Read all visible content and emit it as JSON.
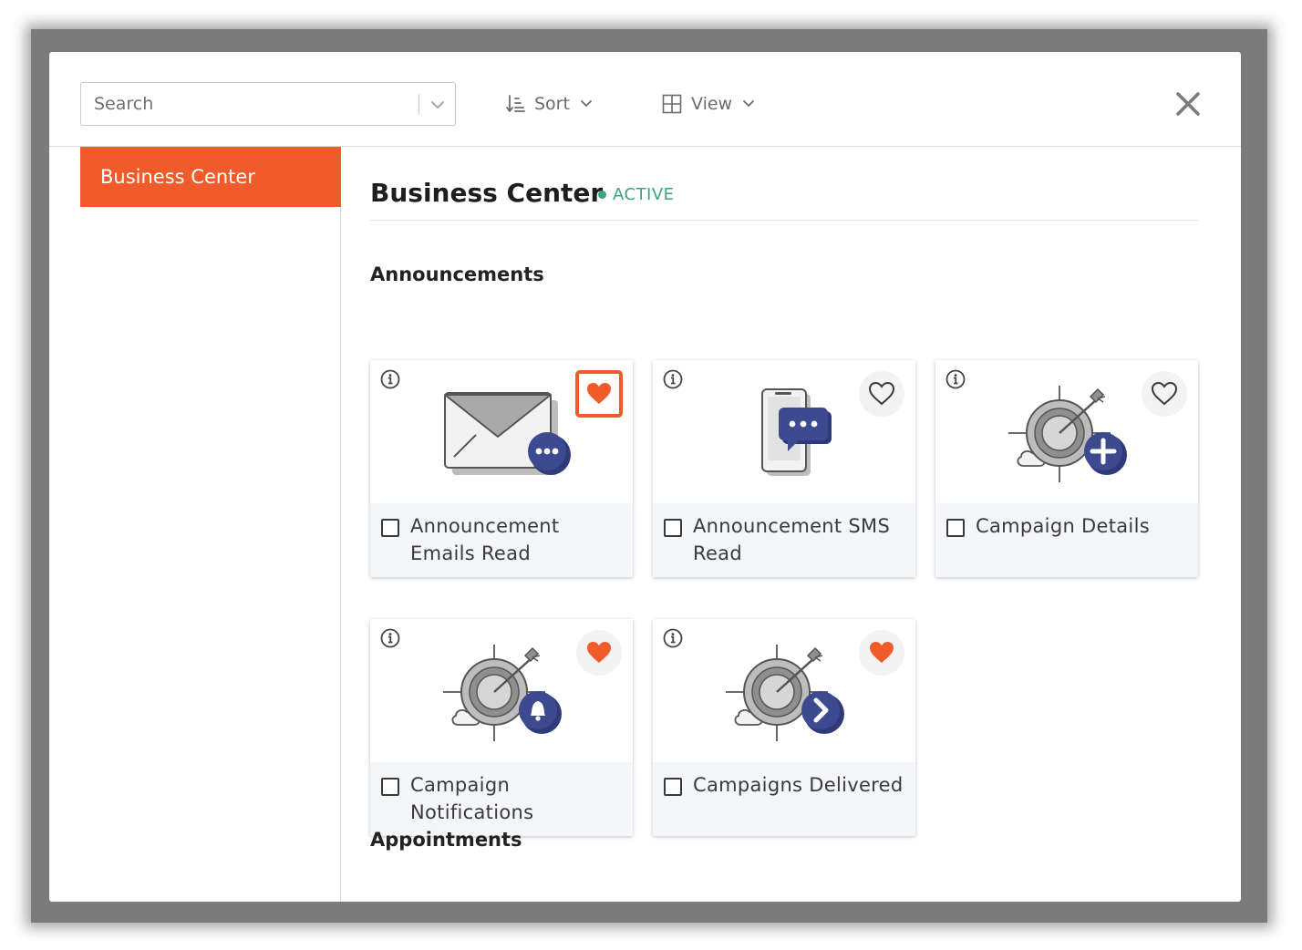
{
  "search": {
    "placeholder": "Search"
  },
  "toolbar": {
    "sort_label": "Sort",
    "view_label": "View"
  },
  "sidebar": {
    "items": [
      {
        "label": "Business Center",
        "active": true
      }
    ]
  },
  "header": {
    "title": "Business Center",
    "status": "ACTIVE",
    "status_color": "#3aa57a"
  },
  "accent_color": "#ef5b2a",
  "icon_color": "#3d4a8f",
  "sections": [
    {
      "title": "Announcements",
      "cards": [
        {
          "label": "Announcement Emails Read",
          "icon": "envelope-chat-icon",
          "favorited": true,
          "checked": false
        },
        {
          "label": "Announcement SMS Read",
          "icon": "phone-chat-icon",
          "favorited": false,
          "checked": false
        },
        {
          "label": "Campaign Details",
          "icon": "target-plus-icon",
          "favorited": false,
          "checked": false
        },
        {
          "label": "Campaign Notifications",
          "icon": "target-bell-icon",
          "favorited": true,
          "checked": false
        },
        {
          "label": "Campaigns Delivered",
          "icon": "target-arrow-icon",
          "favorited": true,
          "checked": false
        }
      ]
    },
    {
      "title": "Appointments",
      "cards": [
        {
          "label": "",
          "favorited": true
        },
        {
          "label": "",
          "favorited": true
        },
        {
          "label": "",
          "favorited": true
        }
      ]
    }
  ]
}
